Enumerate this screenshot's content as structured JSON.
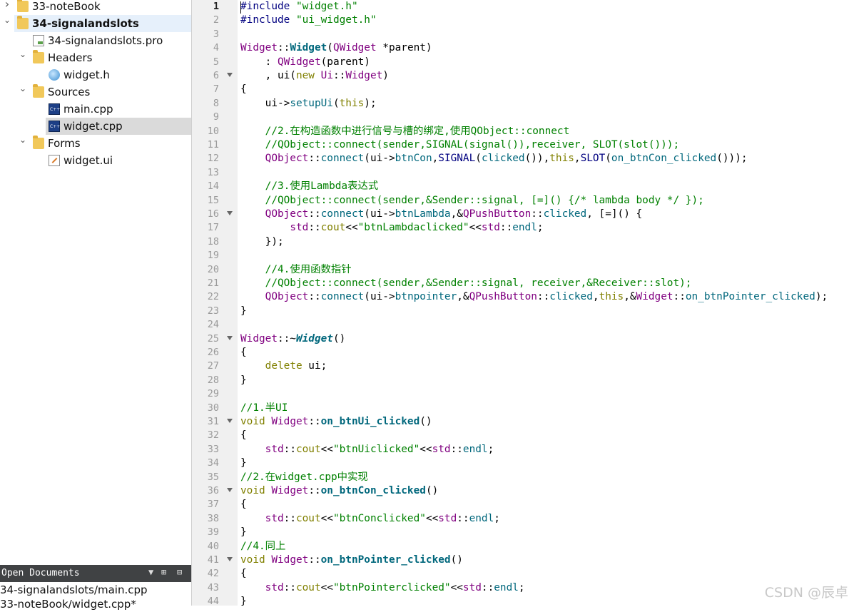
{
  "project_tree": [
    {
      "label": "33-noteBook",
      "icon": "qt-project-folder-icon",
      "arrow": "right",
      "level": 0,
      "bold": false,
      "selected": false
    },
    {
      "label": "34-signalandslots",
      "icon": "qt-project-folder-icon",
      "arrow": "down",
      "level": 0,
      "bold": true,
      "selected": true
    },
    {
      "label": "34-signalandslots.pro",
      "icon": "pro-file-icon",
      "arrow": "",
      "level": 1,
      "bold": false,
      "selected": false
    },
    {
      "label": "Headers",
      "icon": "headers-folder-icon",
      "arrow": "down",
      "level": 1,
      "bold": false,
      "selected": false
    },
    {
      "label": "widget.h",
      "icon": "header-file-icon",
      "arrow": "",
      "level": 2,
      "bold": false,
      "selected": false
    },
    {
      "label": "Sources",
      "icon": "sources-folder-icon",
      "arrow": "down",
      "level": 1,
      "bold": false,
      "selected": false
    },
    {
      "label": "main.cpp",
      "icon": "cpp-file-icon",
      "arrow": "",
      "level": 2,
      "bold": false,
      "selected": false
    },
    {
      "label": "widget.cpp",
      "icon": "cpp-file-icon",
      "arrow": "",
      "level": 2,
      "bold": false,
      "selected": true
    },
    {
      "label": "Forms",
      "icon": "forms-folder-icon",
      "arrow": "down",
      "level": 1,
      "bold": false,
      "selected": false
    },
    {
      "label": "widget.ui",
      "icon": "ui-file-icon",
      "arrow": "",
      "level": 2,
      "bold": false,
      "selected": false
    }
  ],
  "open_documents": {
    "title": "Open Documents",
    "items": [
      "34-signalandslots/main.cpp",
      "33-noteBook/widget.cpp*"
    ]
  },
  "editor": {
    "current_line": 1,
    "fold_lines": [
      6,
      16,
      25,
      31,
      36,
      41
    ],
    "lines": [
      [
        [
          "pre",
          "#include "
        ],
        [
          "str",
          "\"widget.h\""
        ]
      ],
      [
        [
          "pre",
          "#include "
        ],
        [
          "str",
          "\"ui_widget.h\""
        ]
      ],
      [],
      [
        [
          "type",
          "Widget"
        ],
        [
          "p",
          "::"
        ],
        [
          "def",
          "Widget"
        ],
        [
          "p",
          "("
        ],
        [
          "type",
          "QWidget"
        ],
        [
          "p",
          " *"
        ],
        [
          "p",
          "parent)"
        ]
      ],
      [
        [
          "p",
          "    : "
        ],
        [
          "type",
          "QWidget"
        ],
        [
          "p",
          "(parent)"
        ]
      ],
      [
        [
          "p",
          "    , "
        ],
        [
          "p",
          "ui("
        ],
        [
          "kw",
          "new"
        ],
        [
          "p",
          " "
        ],
        [
          "type",
          "Ui"
        ],
        [
          "p",
          "::"
        ],
        [
          "type",
          "Widget"
        ],
        [
          "p",
          ")"
        ]
      ],
      [
        [
          "p",
          "{"
        ]
      ],
      [
        [
          "p",
          "    ui->"
        ],
        [
          "fn",
          "setupUi"
        ],
        [
          "p",
          "("
        ],
        [
          "kw",
          "this"
        ],
        [
          "p",
          ");"
        ]
      ],
      [],
      [
        [
          "cm",
          "    //2.在构造函数中进行信号与槽的绑定,使用QObject::connect"
        ]
      ],
      [
        [
          "cm",
          "    //QObject::connect(sender,SIGNAL(signal()),receiver, SLOT(slot()));"
        ]
      ],
      [
        [
          "p",
          "    "
        ],
        [
          "type",
          "QObject"
        ],
        [
          "p",
          "::"
        ],
        [
          "fn",
          "connect"
        ],
        [
          "p",
          "(ui->"
        ],
        [
          "fn",
          "btnCon"
        ],
        [
          "p",
          ","
        ],
        [
          "mac",
          "SIGNAL"
        ],
        [
          "p",
          "("
        ],
        [
          "fn",
          "clicked"
        ],
        [
          "p",
          "()),"
        ],
        [
          "kw",
          "this"
        ],
        [
          "p",
          ","
        ],
        [
          "mac",
          "SLOT"
        ],
        [
          "p",
          "("
        ],
        [
          "fn",
          "on_btnCon_clicked"
        ],
        [
          "p",
          "()));"
        ]
      ],
      [],
      [
        [
          "cm",
          "    //3.使用Lambda表达式"
        ]
      ],
      [
        [
          "cm",
          "    //QObject::connect(sender,&Sender::signal, [=]() {/* lambda body */ });"
        ]
      ],
      [
        [
          "p",
          "    "
        ],
        [
          "type",
          "QObject"
        ],
        [
          "p",
          "::"
        ],
        [
          "fn",
          "connect"
        ],
        [
          "p",
          "(ui->"
        ],
        [
          "fn",
          "btnLambda"
        ],
        [
          "p",
          ",&"
        ],
        [
          "type",
          "QPushButton"
        ],
        [
          "p",
          "::"
        ],
        [
          "fn",
          "clicked"
        ],
        [
          "p",
          ", [=]() {"
        ]
      ],
      [
        [
          "p",
          "        "
        ],
        [
          "type",
          "std"
        ],
        [
          "p",
          "::"
        ],
        [
          "kw",
          "cout"
        ],
        [
          "p",
          "<<"
        ],
        [
          "str",
          "\"btnLambdaclicked\""
        ],
        [
          "p",
          "<<"
        ],
        [
          "type",
          "std"
        ],
        [
          "p",
          "::"
        ],
        [
          "fn",
          "endl"
        ],
        [
          "p",
          ";"
        ]
      ],
      [
        [
          "p",
          "    });"
        ]
      ],
      [],
      [
        [
          "cm",
          "    //4.使用函数指针"
        ]
      ],
      [
        [
          "cm",
          "    //QObject::connect(sender,&Sender::signal, receiver,&Receiver::slot);"
        ]
      ],
      [
        [
          "p",
          "    "
        ],
        [
          "type",
          "QObject"
        ],
        [
          "p",
          "::"
        ],
        [
          "fn",
          "connect"
        ],
        [
          "p",
          "(ui->"
        ],
        [
          "fn",
          "btnpointer"
        ],
        [
          "p",
          ",&"
        ],
        [
          "type",
          "QPushButton"
        ],
        [
          "p",
          "::"
        ],
        [
          "fn",
          "clicked"
        ],
        [
          "p",
          ","
        ],
        [
          "kw",
          "this"
        ],
        [
          "p",
          ",&"
        ],
        [
          "type",
          "Widget"
        ],
        [
          "p",
          "::"
        ],
        [
          "fn",
          "on_btnPointer_clicked"
        ],
        [
          "p",
          ");"
        ]
      ],
      [
        [
          "p",
          "}"
        ]
      ],
      [],
      [
        [
          "type",
          "Widget"
        ],
        [
          "p",
          "::~"
        ],
        [
          "defi",
          "Widget"
        ],
        [
          "p",
          "()"
        ]
      ],
      [
        [
          "p",
          "{"
        ]
      ],
      [
        [
          "p",
          "    "
        ],
        [
          "kw",
          "delete"
        ],
        [
          "p",
          " ui;"
        ]
      ],
      [
        [
          "p",
          "}"
        ]
      ],
      [],
      [
        [
          "cm",
          "//1.半UI"
        ]
      ],
      [
        [
          "kw",
          "void"
        ],
        [
          "p",
          " "
        ],
        [
          "type",
          "Widget"
        ],
        [
          "p",
          "::"
        ],
        [
          "def",
          "on_btnUi_clicked"
        ],
        [
          "p",
          "()"
        ]
      ],
      [
        [
          "p",
          "{"
        ]
      ],
      [
        [
          "p",
          "    "
        ],
        [
          "type",
          "std"
        ],
        [
          "p",
          "::"
        ],
        [
          "kw",
          "cout"
        ],
        [
          "p",
          "<<"
        ],
        [
          "str",
          "\"btnUiclicked\""
        ],
        [
          "p",
          "<<"
        ],
        [
          "type",
          "std"
        ],
        [
          "p",
          "::"
        ],
        [
          "fn",
          "endl"
        ],
        [
          "p",
          ";"
        ]
      ],
      [
        [
          "p",
          "}"
        ]
      ],
      [
        [
          "cm",
          "//2.在widget.cpp中实现"
        ]
      ],
      [
        [
          "kw",
          "void"
        ],
        [
          "p",
          " "
        ],
        [
          "type",
          "Widget"
        ],
        [
          "p",
          "::"
        ],
        [
          "def",
          "on_btnCon_clicked"
        ],
        [
          "p",
          "()"
        ]
      ],
      [
        [
          "p",
          "{"
        ]
      ],
      [
        [
          "p",
          "    "
        ],
        [
          "type",
          "std"
        ],
        [
          "p",
          "::"
        ],
        [
          "kw",
          "cout"
        ],
        [
          "p",
          "<<"
        ],
        [
          "str",
          "\"btnConclicked\""
        ],
        [
          "p",
          "<<"
        ],
        [
          "type",
          "std"
        ],
        [
          "p",
          "::"
        ],
        [
          "fn",
          "endl"
        ],
        [
          "p",
          ";"
        ]
      ],
      [
        [
          "p",
          "}"
        ]
      ],
      [
        [
          "cm",
          "//4.同上"
        ]
      ],
      [
        [
          "kw",
          "void"
        ],
        [
          "p",
          " "
        ],
        [
          "type",
          "Widget"
        ],
        [
          "p",
          "::"
        ],
        [
          "def",
          "on_btnPointer_clicked"
        ],
        [
          "p",
          "()"
        ]
      ],
      [
        [
          "p",
          "{"
        ]
      ],
      [
        [
          "p",
          "    "
        ],
        [
          "type",
          "std"
        ],
        [
          "p",
          "::"
        ],
        [
          "kw",
          "cout"
        ],
        [
          "p",
          "<<"
        ],
        [
          "str",
          "\"btnPointerclicked\""
        ],
        [
          "p",
          "<<"
        ],
        [
          "type",
          "std"
        ],
        [
          "p",
          "::"
        ],
        [
          "fn",
          "endl"
        ],
        [
          "p",
          ";"
        ]
      ],
      [
        [
          "p",
          "}"
        ]
      ]
    ]
  },
  "watermark": "CSDN @辰卓"
}
